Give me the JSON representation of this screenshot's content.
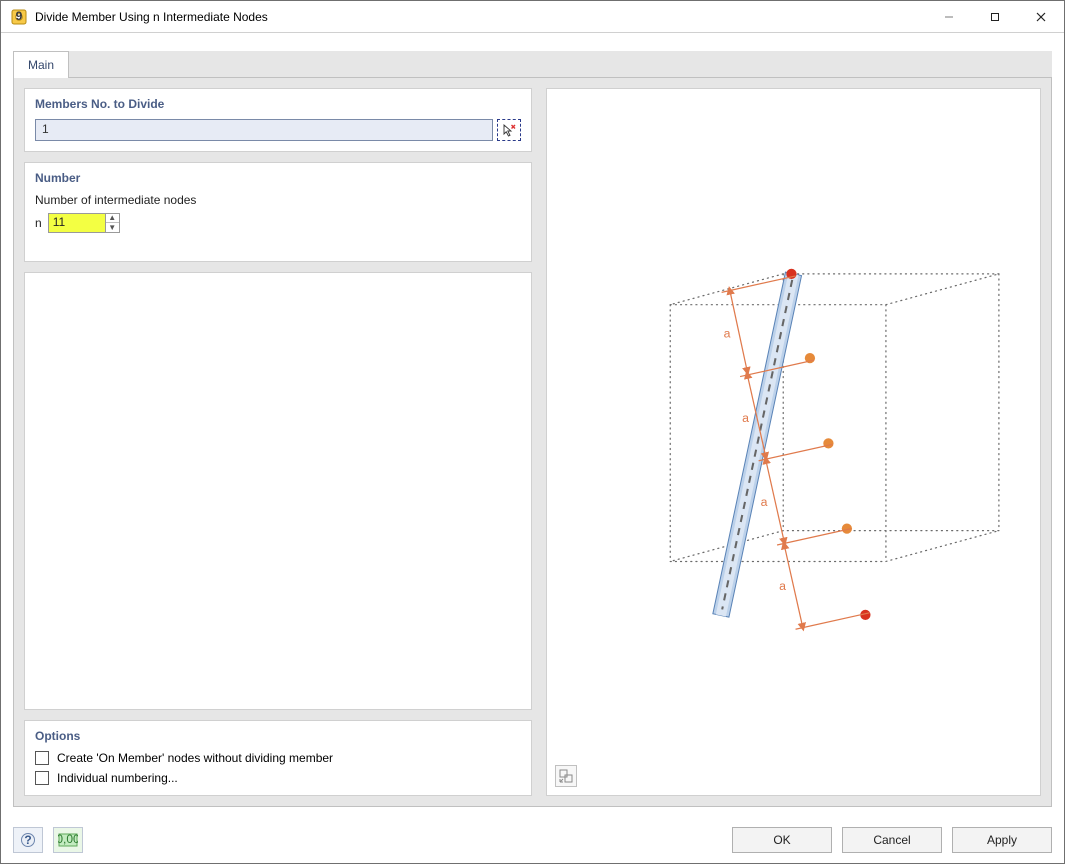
{
  "window": {
    "title": "Divide Member Using n Intermediate Nodes"
  },
  "tabs": {
    "main": "Main"
  },
  "members": {
    "title": "Members No. to Divide",
    "value": "1"
  },
  "number": {
    "title": "Number",
    "label": "Number of intermediate nodes",
    "prefix": "n",
    "value": "11"
  },
  "options": {
    "title": "Options",
    "opt1": "Create 'On Member' nodes without dividing member",
    "opt2": "Individual numbering..."
  },
  "preview": {
    "seg_label": "a"
  },
  "buttons": {
    "ok": "OK",
    "cancel": "Cancel",
    "apply": "Apply"
  }
}
